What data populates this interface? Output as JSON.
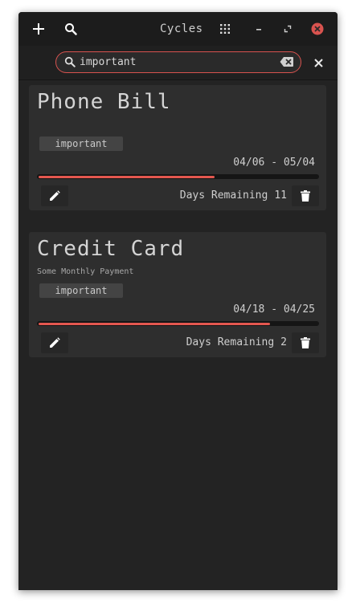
{
  "window": {
    "title": "Cycles",
    "accent_color": "#e4574f",
    "close_color": "#d9534f"
  },
  "titlebar": {
    "add_icon": "plus-icon",
    "search_icon": "search-icon",
    "grid_icon": "grid-dots-icon",
    "minimize_icon": "minimize-icon",
    "restore_icon": "restore-icon",
    "close_icon": "close-circle-icon"
  },
  "search": {
    "value": "important",
    "placeholder": ""
  },
  "cycles": [
    {
      "title": "Phone Bill",
      "subtitle": "",
      "tag": "important",
      "date_range": "04/06 - 05/04",
      "progress": 0.63,
      "days_label": "Days Remaining",
      "days_value": "11"
    },
    {
      "title": "Credit Card",
      "subtitle": "Some Monthly Payment",
      "tag": "important",
      "date_range": "04/18 - 04/25",
      "progress": 0.83,
      "days_label": "Days Remaining",
      "days_value": "2"
    }
  ]
}
